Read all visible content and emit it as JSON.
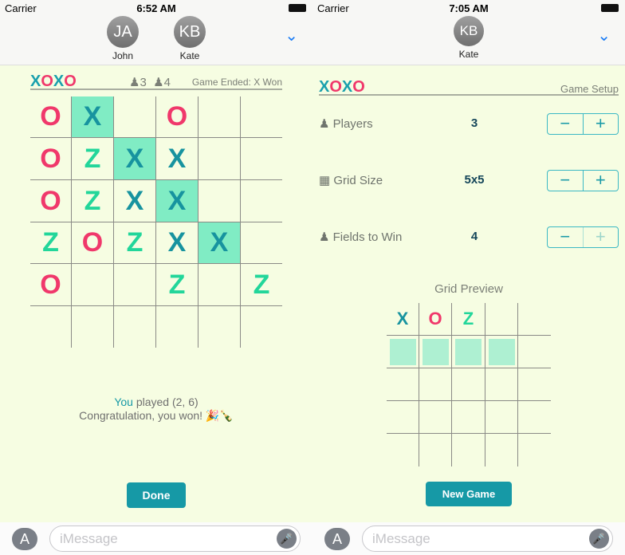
{
  "colors": {
    "x": "#17939f",
    "o": "#f0386b",
    "z": "#22d69a",
    "highlight": "#80ecc4",
    "accent": "#1699a6",
    "background": "#f6fde2"
  },
  "left": {
    "status": {
      "carrier": "Carrier",
      "time": "6:52 AM"
    },
    "contacts": [
      {
        "initials": "JA",
        "name": "John"
      },
      {
        "initials": "KB",
        "name": "Kate"
      }
    ],
    "logo": [
      "X",
      "O",
      "X",
      "O"
    ],
    "players_count": "3",
    "win_count": "4",
    "game_status": "Game Ended: X Won",
    "board": {
      "rows": [
        [
          "O",
          "X",
          "",
          "O",
          "",
          ""
        ],
        [
          "O",
          "Z",
          "X",
          "X",
          "",
          ""
        ],
        [
          "O",
          "Z",
          "X",
          "X",
          "",
          ""
        ],
        [
          "Z",
          "O",
          "Z",
          "X",
          "X",
          ""
        ],
        [
          "O",
          "",
          "",
          "Z",
          "",
          "Z"
        ],
        [
          "",
          "",
          "",
          "",
          "",
          ""
        ]
      ],
      "highlighted": [
        [
          0,
          1
        ],
        [
          1,
          2
        ],
        [
          2,
          3
        ],
        [
          3,
          4
        ]
      ]
    },
    "message": {
      "you": "You",
      "played": " played (2, 6)",
      "congrats": "Congratulation, you won! 🎉🍾"
    },
    "done_label": "Done",
    "imessage_placeholder": "iMessage"
  },
  "right": {
    "status": {
      "carrier": "Carrier",
      "time": "7:05 AM"
    },
    "contacts": [
      {
        "initials": "KB",
        "name": "Kate"
      }
    ],
    "logo": [
      "X",
      "O",
      "X",
      "O"
    ],
    "section_title": "Game Setup",
    "settings": [
      {
        "label": "Players",
        "value": "3",
        "icon": "person-add-icon"
      },
      {
        "label": "Grid Size",
        "value": "5x5",
        "icon": "grid-icon"
      },
      {
        "label": "Fields to Win",
        "value": "4",
        "icon": "pawn-icon",
        "plus_disabled": true
      }
    ],
    "preview_title": "Grid Preview",
    "preview": {
      "symbols": [
        "X",
        "O",
        "Z"
      ],
      "win_fields": 4
    },
    "new_game_label": "New Game",
    "imessage_placeholder": "iMessage"
  }
}
